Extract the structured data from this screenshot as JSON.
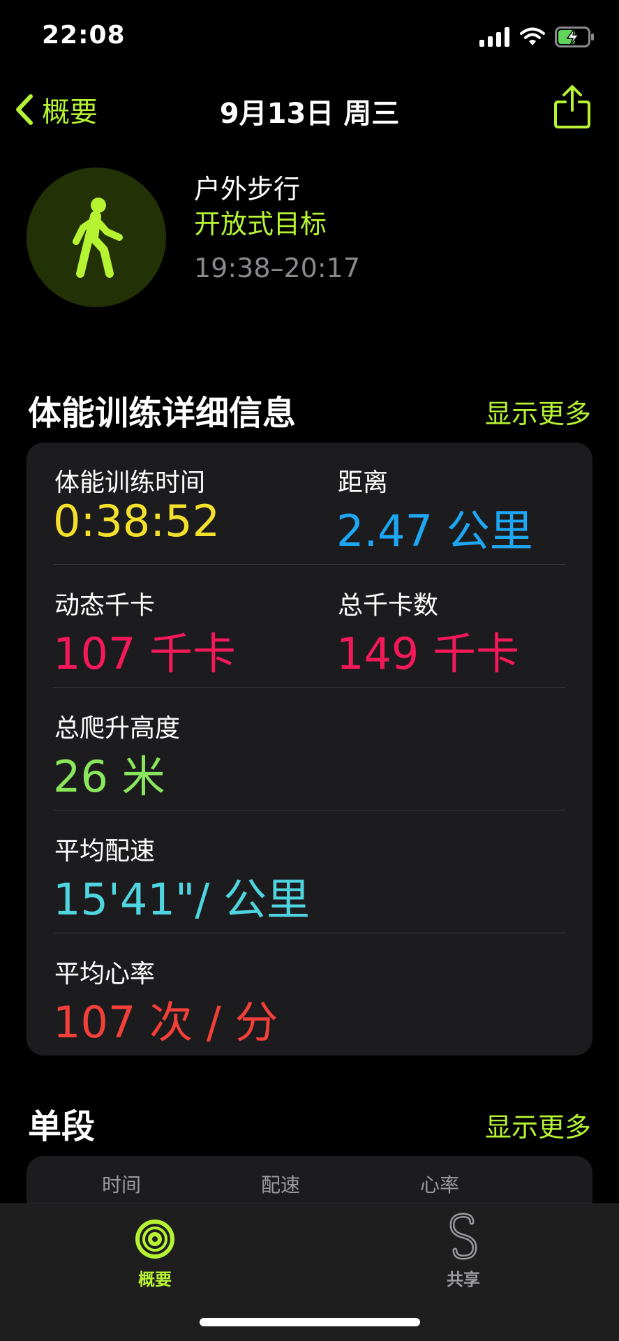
{
  "status": {
    "time": "22:08"
  },
  "nav": {
    "back_label": "概要",
    "title": "9月13日 周三"
  },
  "workout": {
    "name": "户外步行",
    "goal": "开放式目标",
    "time_range": "19:38–20:17"
  },
  "details": {
    "title": "体能训练详细信息",
    "show_more": "显示更多",
    "stats": [
      {
        "label": "体能训练时间",
        "value": "0:38:52",
        "color": "#f5e12c"
      },
      {
        "label": "距离",
        "value": "2.47 公里",
        "color": "#1ea7f5"
      },
      {
        "label": "动态千卡",
        "value": "107 千卡",
        "color": "#f5195a"
      },
      {
        "label": "总千卡数",
        "value": "149 千卡",
        "color": "#f5195a"
      },
      {
        "label": "总爬升高度",
        "value": "26 米",
        "color": "#8ae65c"
      },
      {
        "label": "平均配速",
        "value": "15'41\"/ 公里",
        "color": "#4fd5e0"
      },
      {
        "label": "平均心率",
        "value": "107 次 / 分",
        "color": "#f5403a"
      }
    ]
  },
  "splits": {
    "title": "单段",
    "show_more": "显示更多",
    "columns": [
      "时间",
      "配速",
      "心率"
    ]
  },
  "tabbar": {
    "tabs": [
      {
        "label": "概要",
        "icon": "activity-rings-icon",
        "active": true
      },
      {
        "label": "共享",
        "icon": "sharing-icon",
        "active": false
      }
    ]
  },
  "colors": {
    "accent": "#b6f433",
    "card": "#1c1c1e"
  }
}
